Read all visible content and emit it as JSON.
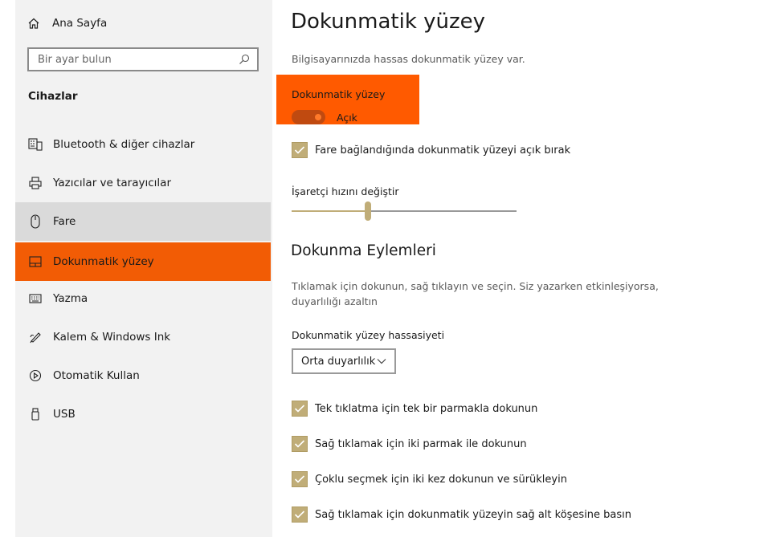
{
  "sidebar": {
    "home_label": "Ana Sayfa",
    "search_placeholder": "Bir ayar bulun",
    "section_title": "Cihazlar",
    "items": [
      {
        "label": "Bluetooth & diğer cihazlar",
        "icon": "bluetooth-devices-icon"
      },
      {
        "label": "Yazıcılar ve tarayıcılar",
        "icon": "printer-icon"
      },
      {
        "label": "Fare",
        "icon": "mouse-icon"
      },
      {
        "label": "Dokunmatik yüzey",
        "icon": "touchpad-icon"
      },
      {
        "label": "Yazma",
        "icon": "keyboard-icon"
      },
      {
        "label": "Kalem & Windows Ink",
        "icon": "pen-icon"
      },
      {
        "label": "Otomatik Kullan",
        "icon": "autoplay-icon"
      },
      {
        "label": "USB",
        "icon": "usb-icon"
      }
    ],
    "active_item": "Dokunmatik yüzey",
    "hover_item": "Fare"
  },
  "main": {
    "title": "Dokunmatik yüzey",
    "description": "Bilgisayarınızda hassas dokunmatik yüzey var.",
    "toggle_label": "Dokunmatik yüzey",
    "toggle_state": "Açık",
    "toggle_on": true,
    "leave_on_checkbox": "Fare bağlandığında dokunmatik yüzeyi açık bırak",
    "pointer_speed_label": "İşaretçi hızını değiştir",
    "pointer_speed_fraction": 0.34,
    "taps_title": "Dokunma Eylemleri",
    "taps_description": "Tıklamak için dokunun, sağ tıklayın ve seçin. Siz yazarken etkinleşiyorsa, duyarlılığı azaltın",
    "sensitivity_label": "Dokunmatik yüzey hassasiyeti",
    "sensitivity_value": "Orta duyarlılık",
    "tap_options": [
      "Tek tıklatma için tek bir parmakla dokunun",
      "Sağ tıklamak için iki parmak ile dokunun",
      "Çoklu seçmek için iki kez dokunun ve sürükleyin",
      "Sağ tıklamak için dokunmatik yüzeyin sağ alt köşesine basın"
    ]
  },
  "colors": {
    "accent_orange": "#f25c05",
    "highlight_orange": "#ff5a00",
    "checkbox_gold": "#c0ad78",
    "sidebar_bg": "#f2f2f2"
  }
}
